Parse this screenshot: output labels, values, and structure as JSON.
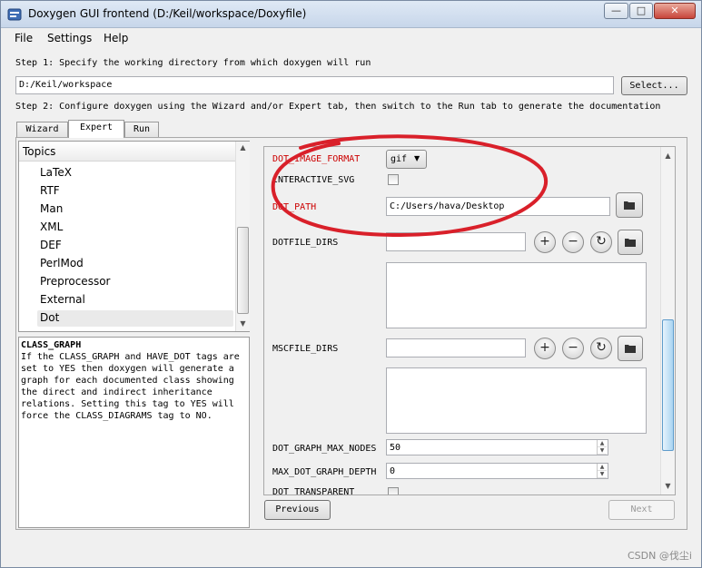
{
  "window": {
    "title": "Doxygen GUI frontend (D:/Keil/workspace/Doxyfile)"
  },
  "menu": [
    "File",
    "Settings",
    "Help"
  ],
  "step1": {
    "label": "Step 1: Specify the working directory from which doxygen will run",
    "dir": "D:/Keil/workspace",
    "select_label": "Select..."
  },
  "step2": {
    "label": "Step 2: Configure doxygen using the Wizard and/or Expert tab, then switch to the Run tab to generate the documentation"
  },
  "tabs": [
    "Wizard",
    "Expert",
    "Run"
  ],
  "topics": {
    "header": "Topics",
    "items": [
      "LaTeX",
      "RTF",
      "Man",
      "XML",
      "DEF",
      "PerlMod",
      "Preprocessor",
      "External",
      "Dot"
    ],
    "selected": "Dot"
  },
  "help": {
    "title": "CLASS_GRAPH",
    "lines": [
      "If the CLASS_GRAPH and HAVE_DOT tags are",
      "set to YES then doxygen will generate a",
      "graph for each documented class showing",
      "the direct and indirect inheritance",
      "relations. Setting this tag to YES will",
      "force the CLASS_DIAGRAMS tag to NO."
    ]
  },
  "settings": {
    "dot_image_format": {
      "label": "DOT_IMAGE_FORMAT",
      "value": "gif"
    },
    "interactive_svg": {
      "label": "INTERACTIVE_SVG"
    },
    "dot_path": {
      "label": "DOT_PATH",
      "value": "C:/Users/hava/Desktop"
    },
    "dotfile_dirs": {
      "label": "DOTFILE_DIRS"
    },
    "mscfile_dirs": {
      "label": "MSCFILE_DIRS"
    },
    "dot_graph_max_nodes": {
      "label": "DOT_GRAPH_MAX_NODES",
      "value": "50"
    },
    "max_dot_graph_depth": {
      "label": "MAX_DOT_GRAPH_DEPTH",
      "value": "0"
    },
    "dot_transparent": {
      "label": "DOT_TRANSPARENT"
    }
  },
  "nav": {
    "previous": "Previous",
    "next": "Next"
  },
  "watermark": "CSDN @伐尘i",
  "annotation_color": "#d9202a"
}
